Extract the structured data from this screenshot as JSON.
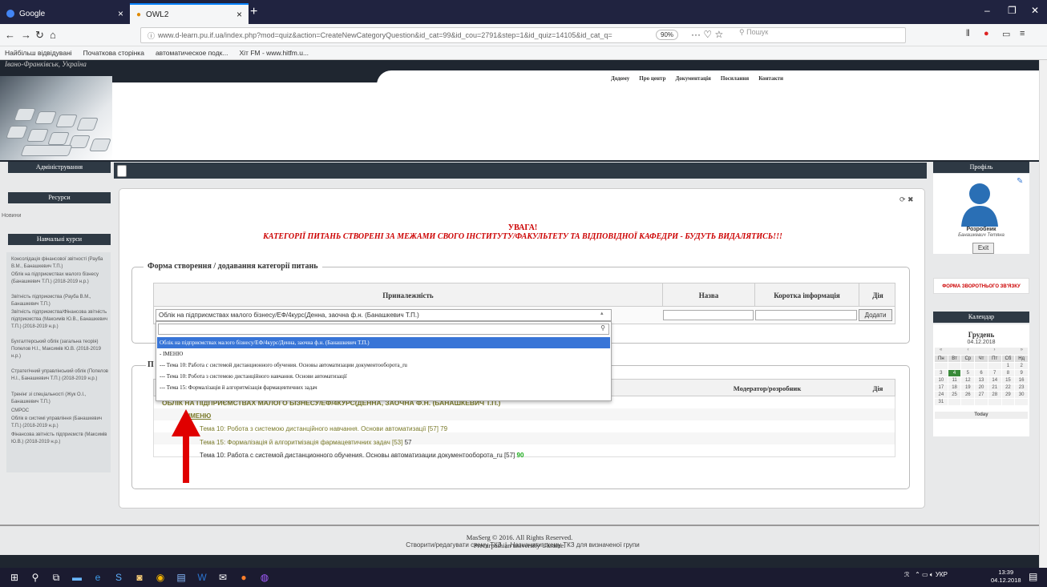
{
  "browser": {
    "tabs": [
      {
        "title": "Google"
      },
      {
        "title": "OWL2"
      }
    ],
    "url": "www.d-learn.pu.if.ua/index.php?mod=quiz&action=CreateNewCategoryQuestion&id_cat=99&id_cou=2791&step=1&id_quiz=14105&id_cat_q=",
    "zoom": "90%",
    "search_placeholder": "Пошук",
    "bookmarks": [
      "Найбільш відвідувані",
      "Початкова сторінка",
      "автоматическое подк...",
      "Хіт FM - www.hitfm.u..."
    ]
  },
  "header": {
    "city": "Івано-Франківськ, Україна",
    "nav": [
      "Додому",
      "Про центр",
      "Документація",
      "Посилання",
      "Контакти"
    ]
  },
  "left_sidebar": {
    "admin": "Адміністрування",
    "resources": "Ресурси",
    "news": "Новини",
    "courses_title": "Навчальні курси",
    "courses": [
      "Консолідація фінансової звітності (Рауба В.М., Банашкевич Т.П.)",
      "Облік на підприємствах малого бізнесу (Банашкевич Т.П.) (2018-2019 н.р.)",
      "Звітність підприємства (Рауба В.М., Банашкевич Т.П.)",
      "Звітність підприємства/Фінансова звітність підприємства (Максимів Ю.В., Банашкевич Т.П.) (2018-2019 н.р.)",
      "Бухгалтерський облік (загальна теорія) Попелов Н.І., Максимів Ю.В. (2018-2019 н.р.)",
      "Стратегічний управлінський облік (Попелов Н.І., Банашкевич Т.П.) (2018-2019 н.р.)",
      "Тренінг зі спеціальності (Жук О.І., Банашкевич Т.П.)",
      "СМРОС",
      "Облік в системі управління (Банашкевич Т.П.) (2018-2019 н.р.)",
      "Фінансова звітність підприємств (Максимів Ю.В.) (2018-2019 н.р.)"
    ]
  },
  "main": {
    "warning_title": "УВАГА!",
    "warning_text": "КАТЕГОРІЇ ПИТАНЬ СТВОРЕНІ ЗА МЕЖАМИ СВОГО ІНСТИТУТУ/ФАКУЛЬТЕТУ ТА ВІДПОВІДНОЇ КАФЕДРИ - БУДУТЬ ВИДАЛЯТИСЬ!!!",
    "form_legend": "Форма створення / додавання категорії питань",
    "columns": [
      "Приналежність",
      "Назва",
      "Коротка інформація",
      "Дія"
    ],
    "select_value": "Облік на підприємствах малого бізнесу/ЕФ/4курс(Денна, заочна ф.н. (Банашкевич Т.П.)",
    "add_button": "Додати",
    "dropdown_options": [
      "Облік на підприємствах малого бізнесу/ЕФ/4курс/Денна, заочна ф.н. (Банашкевич Т.П.)",
      "- ІМЕНЮ",
      "--- Тема 10: Работа с системой дистанционного обучения. Основы автоматизации документооборота_ru",
      "--- Тема 10: Робота з системою дистанційного навчання. Основи автоматизації",
      "--- Тема 15: Формалізація й алгоритмізація фармацевтичних задач"
    ],
    "list_legend": "П",
    "list_columns": [
      "Модератор/розробник",
      "Дія"
    ],
    "category_upper": "ОБЛІК НА ПІДПРИЄМСТВАХ МАЛОГО БІЗНЕСУ/ЕФ/4КУРС(ДЕННА, ЗАОЧНА Ф.Н. (БАНАШКЕВИЧ Т.П.)",
    "category_sub": "ІМЕНЮ",
    "themes": [
      {
        "text": "Тема 10: Робота з системою дистанційного навчання. Основи автоматизації [57]",
        "count": "79"
      },
      {
        "text": "Тема 15: Формалізація й алгоритмізація фармацевтичних задач [53]",
        "count": "57"
      },
      {
        "text": "Тема 10: Работа с системой дистанционного обучения. Основы автоматизации документооборота_ru [57]",
        "count": "90"
      }
    ],
    "link1": "Створити/редагувати схему ТКЗ",
    "link2": "Назначити схему ТКЗ для визначеної групи"
  },
  "right_sidebar": {
    "profile": "Профіль",
    "role": "Розробник",
    "name": "Банашкевич Тетяна",
    "exit": "Exit",
    "feedback": "ФОРМА ЗВОРОТНЬОГО ЗВ'ЯЗКУ",
    "calendar": "Календар",
    "month": "Грудень",
    "date": "04.12.2018",
    "weekdays": [
      "Пн",
      "Вт",
      "Ср",
      "Чт",
      "Пт",
      "Сб",
      "Нд"
    ],
    "days": [
      "",
      "",
      "",
      "",
      "",
      "1",
      "2",
      "3",
      "4",
      "5",
      "6",
      "7",
      "8",
      "9",
      "10",
      "11",
      "12",
      "13",
      "14",
      "15",
      "16",
      "17",
      "18",
      "19",
      "20",
      "21",
      "22",
      "23",
      "24",
      "25",
      "26",
      "27",
      "28",
      "29",
      "30",
      "31",
      "",
      "",
      "",
      "",
      "",
      ""
    ],
    "today_label": "Today"
  },
  "footer": {
    "copyright": "MasSerg © 2016. All Rights Reserved.",
    "university": "Precarpathian university Ukraine."
  },
  "taskbar": {
    "lang": "УКР",
    "time": "13:39",
    "date": "04.12.2018"
  },
  "colors": {
    "accent_dark": "#2e3944",
    "warning_red": "#cc0000",
    "selected_option": "#3875d7"
  }
}
